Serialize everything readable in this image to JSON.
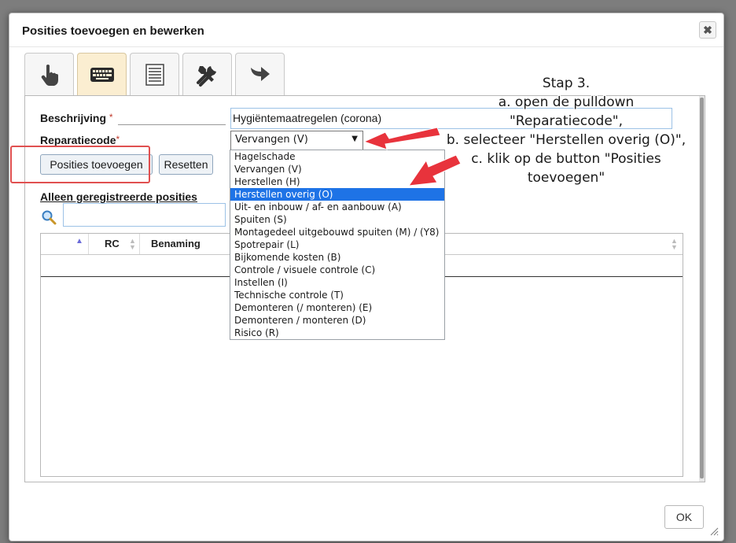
{
  "dialog": {
    "title": "Posities toevoegen en bewerken",
    "close_icon": "close-icon",
    "ok_label": "OK"
  },
  "tabs": [
    {
      "icon": "hand-pointer-icon"
    },
    {
      "icon": "keyboard-icon",
      "active": true
    },
    {
      "icon": "list-icon"
    },
    {
      "icon": "tools-icon"
    },
    {
      "icon": "arrow-right-icon"
    }
  ],
  "form": {
    "beschrijving_label": "Beschrijving",
    "beschrijving_value": "Hygiëntemaatregelen (corona)",
    "reparatiecode_label": "Reparatiecode",
    "reparatiecode_value": "Vervangen (V)",
    "required_mark": "*",
    "add_button": "Posities toevoegen",
    "reset_button": "Resetten",
    "registered_heading": "Alleen geregistreerde posities",
    "search_icon": "search-icon"
  },
  "grid": {
    "columns": [
      "RC",
      "Benaming"
    ]
  },
  "dropdown": {
    "options": [
      "Hagelschade",
      "Vervangen (V)",
      "Herstellen (H)",
      "Herstellen overig (O)",
      "Uit- en inbouw / af- en aanbouw (A)",
      "Spuiten (S)",
      "Montagedeel uitgebouwd spuiten (M) / (Y8)",
      "Spotrepair (L)",
      "Bijkomende kosten (B)",
      "Controle / visuele controle (C)",
      "Instellen (I)",
      "Technische controle (T)",
      "Demonteren (/ monteren) (E)",
      "Demonteren / monteren (D)",
      "Risico (R)"
    ],
    "selected_index": 3
  },
  "annotation": {
    "lines": [
      "Stap 3.",
      "a. open de pulldown",
      "\"Reparatiecode\",",
      "b. selecteer \"Herstellen overig (O)\",",
      "c. klik op de button \"Posities",
      "toevoegen\""
    ],
    "arrow_color": "#e8333c",
    "highlight_color": "#e05050"
  },
  "colors": {
    "active_tab": "#fbeed1",
    "selected_option": "#1e73e6",
    "required": "#c0392b"
  }
}
